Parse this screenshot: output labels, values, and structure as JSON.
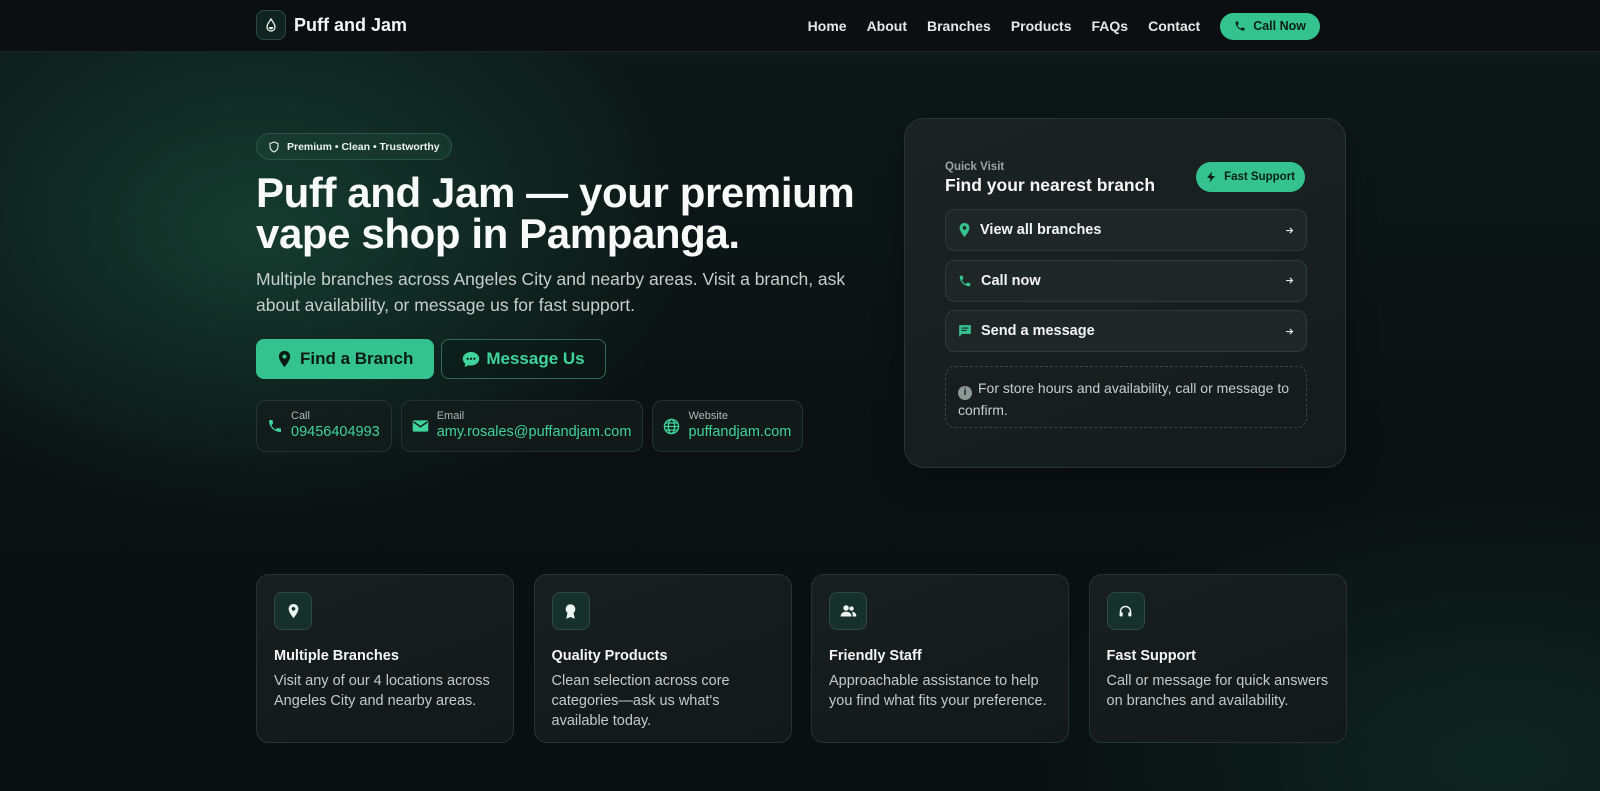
{
  "colors": {
    "accent": "#34c38f",
    "accent_text": "#3fd49b",
    "background": "#0b1113"
  },
  "nav": {
    "brand": "Puff and Jam",
    "brand_icon": "droplet-icon",
    "links": [
      "Home",
      "About",
      "Branches",
      "Products",
      "FAQs",
      "Contact"
    ],
    "cta_label": "Call Now",
    "cta_icon": "phone-icon"
  },
  "hero": {
    "pill": "Premium • Clean • Trustworthy",
    "pill_icon": "shield-icon",
    "headline_line1": "Puff and Jam — your premium",
    "headline_line2": "vape shop in Pampanga.",
    "subtext": "Multiple branches across Angeles City and nearby areas. Visit a branch, ask about availability, or message us for fast support.",
    "primary_cta": "Find a Branch",
    "primary_icon": "map-pin-icon",
    "secondary_cta": "Message Us",
    "secondary_icon": "chat-bubble-icon",
    "contacts": [
      {
        "label": "Call",
        "value": "09456404993",
        "icon": "phone-icon"
      },
      {
        "label": "Email",
        "value": "amy.rosales@puffandjam.com",
        "icon": "mail-icon"
      },
      {
        "label": "Website",
        "value": "puffandjam.com",
        "icon": "globe-icon"
      }
    ]
  },
  "quick_visit": {
    "eyebrow": "Quick Visit",
    "title": "Find your nearest branch",
    "badge": "Fast Support",
    "badge_icon": "bolt-icon",
    "items": [
      {
        "label": "View all branches",
        "icon": "map-pin-icon"
      },
      {
        "label": "Call now",
        "icon": "phone-icon"
      },
      {
        "label": "Send a message",
        "icon": "message-icon"
      }
    ],
    "note": "For store hours and availability, call or message to confirm.",
    "note_icon": "info-icon"
  },
  "features": [
    {
      "title": "Multiple Branches",
      "text": "Visit any of our 4 locations across Angeles City and nearby areas.",
      "icon": "map-pin-icon"
    },
    {
      "title": "Quality Products",
      "text": "Clean selection across core categories—ask us what's available today.",
      "icon": "award-icon"
    },
    {
      "title": "Friendly Staff",
      "text": "Approachable assistance to help you find what fits your preference.",
      "icon": "users-icon"
    },
    {
      "title": "Fast Support",
      "text": "Call or message for quick answers on branches and availability.",
      "icon": "headset-icon"
    }
  ]
}
